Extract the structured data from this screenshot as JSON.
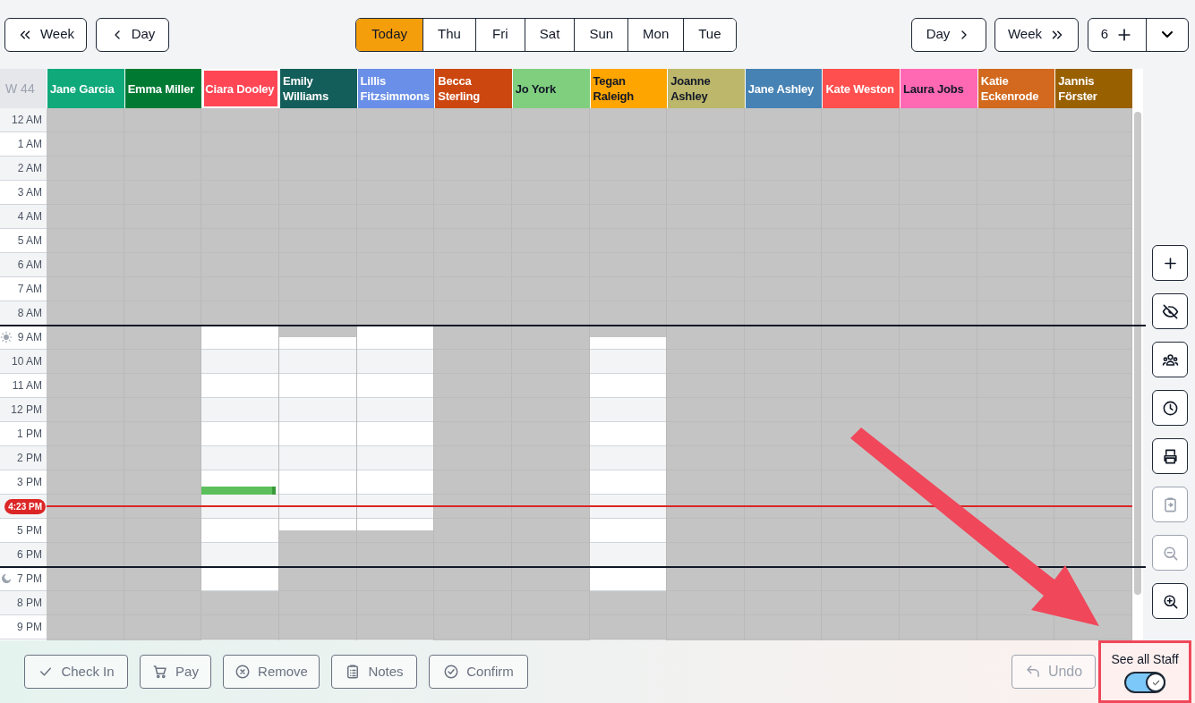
{
  "nav": {
    "prev_week": "Week",
    "prev_day": "Day",
    "next_day": "Day",
    "next_week": "Week"
  },
  "day_tabs": [
    {
      "label": "Today",
      "selected": true
    },
    {
      "label": "Thu",
      "selected": false
    },
    {
      "label": "Fri",
      "selected": false
    },
    {
      "label": "Sat",
      "selected": false
    },
    {
      "label": "Sun",
      "selected": false
    },
    {
      "label": "Mon",
      "selected": false
    },
    {
      "label": "Tue",
      "selected": false
    }
  ],
  "add_count": "6",
  "week_label": "W 44",
  "staff": [
    {
      "name": "Jane Garcia",
      "color": "#10a97a",
      "label_dark": false,
      "selected": false,
      "booking": false
    },
    {
      "name": "Emma Miller",
      "color": "#007a33",
      "label_dark": false,
      "selected": false,
      "booking": false
    },
    {
      "name": "Ciara Dooley",
      "color": "#ff4655",
      "label_dark": false,
      "selected": true,
      "booking": true,
      "open_slots": [
        false,
        false,
        false,
        false,
        false,
        false,
        false,
        false,
        false,
        false,
        false,
        false,
        false,
        false,
        false,
        false,
        false,
        false,
        true,
        true,
        true,
        true,
        true,
        true,
        true,
        true,
        true,
        true,
        true,
        true,
        true,
        true,
        true,
        true,
        true,
        true,
        true,
        true,
        true,
        true,
        false,
        false,
        false,
        false
      ]
    },
    {
      "name": "Emily Williams",
      "color": "#135e5a",
      "label_dark": false,
      "selected": false,
      "booking": false,
      "open_slots": [
        false,
        false,
        false,
        false,
        false,
        false,
        false,
        false,
        false,
        false,
        false,
        false,
        false,
        false,
        false,
        false,
        false,
        false,
        false,
        true,
        true,
        true,
        true,
        true,
        true,
        true,
        true,
        true,
        true,
        true,
        true,
        true,
        true,
        true,
        true,
        false,
        false,
        false,
        false,
        false,
        false,
        false,
        false,
        false
      ]
    },
    {
      "name": "Lillis Fitzsimmons",
      "color": "#6a8fe8",
      "label_dark": false,
      "selected": false,
      "booking": false,
      "open_slots": [
        false,
        false,
        false,
        false,
        false,
        false,
        false,
        false,
        false,
        false,
        false,
        false,
        false,
        false,
        false,
        false,
        false,
        false,
        true,
        true,
        true,
        true,
        true,
        true,
        true,
        true,
        true,
        true,
        true,
        true,
        true,
        true,
        true,
        true,
        true,
        false,
        false,
        false,
        false,
        false,
        false,
        false,
        false,
        false
      ]
    },
    {
      "name": "Becca Sterling",
      "color": "#cc470f",
      "label_dark": false,
      "selected": false,
      "booking": false
    },
    {
      "name": "Jo York",
      "color": "#80cf7e",
      "label_dark": true,
      "selected": false,
      "booking": false
    },
    {
      "name": "Tegan Raleigh",
      "color": "#ffa500",
      "label_dark": true,
      "selected": false,
      "booking": false,
      "open_slots": [
        false,
        false,
        false,
        false,
        false,
        false,
        false,
        false,
        false,
        false,
        false,
        false,
        false,
        false,
        false,
        false,
        false,
        false,
        false,
        true,
        true,
        true,
        true,
        true,
        true,
        true,
        true,
        true,
        true,
        true,
        true,
        true,
        true,
        true,
        true,
        true,
        true,
        true,
        true,
        true,
        false,
        false,
        false,
        false
      ]
    },
    {
      "name": "Joanne Ashley",
      "color": "#bdb76b",
      "label_dark": true,
      "selected": false,
      "booking": false
    },
    {
      "name": "Jane Ashley",
      "color": "#4682b4",
      "label_dark": false,
      "selected": false,
      "booking": false
    },
    {
      "name": "Kate Weston",
      "color": "#ff4f4f",
      "label_dark": false,
      "selected": false,
      "booking": false
    },
    {
      "name": "Laura Jobs",
      "color": "#ff69b4",
      "label_dark": true,
      "selected": false,
      "booking": false
    },
    {
      "name": "Katie Eckenrode",
      "color": "#d2691e",
      "label_dark": false,
      "selected": false,
      "booking": false
    },
    {
      "name": "Jannis Förster",
      "color": "#996000",
      "label_dark": false,
      "selected": false,
      "booking": false
    }
  ],
  "hours": [
    {
      "label": "12 AM",
      "kind": "hour"
    },
    {
      "label": "1 AM",
      "kind": "hour"
    },
    {
      "label": "2 AM",
      "kind": "hour"
    },
    {
      "label": "3 AM",
      "kind": "hour"
    },
    {
      "label": "4 AM",
      "kind": "hour"
    },
    {
      "label": "5 AM",
      "kind": "hour"
    },
    {
      "label": "6 AM",
      "kind": "hour"
    },
    {
      "label": "7 AM",
      "kind": "hour"
    },
    {
      "label": "8 AM",
      "kind": "hour"
    },
    {
      "label": "9 AM",
      "kind": "sunrise"
    },
    {
      "label": "10 AM",
      "kind": "hour"
    },
    {
      "label": "11 AM",
      "kind": "hour"
    },
    {
      "label": "12 PM",
      "kind": "hour"
    },
    {
      "label": "1 PM",
      "kind": "hour"
    },
    {
      "label": "2 PM",
      "kind": "hour"
    },
    {
      "label": "3 PM",
      "kind": "hour"
    },
    {
      "label": "4:23 PM",
      "kind": "now"
    },
    {
      "label": "5 PM",
      "kind": "hour"
    },
    {
      "label": "6 PM",
      "kind": "hour"
    },
    {
      "label": "7 PM",
      "kind": "sunset"
    },
    {
      "label": "8 PM",
      "kind": "hour"
    },
    {
      "label": "9 PM",
      "kind": "hour"
    }
  ],
  "tools": [
    {
      "kind": "add",
      "disabled": false
    },
    {
      "kind": "hide",
      "disabled": false
    },
    {
      "kind": "people",
      "disabled": false
    },
    {
      "kind": "clock",
      "disabled": false
    },
    {
      "kind": "print",
      "disabled": false
    },
    {
      "kind": "paste",
      "disabled": true
    },
    {
      "kind": "zoom_out",
      "disabled": true
    },
    {
      "kind": "zoom_in",
      "disabled": false
    }
  ],
  "actions": [
    {
      "label": "Check In",
      "kind": "check"
    },
    {
      "label": "Pay",
      "kind": "cart"
    },
    {
      "label": "Remove",
      "kind": "remove"
    },
    {
      "label": "Notes",
      "kind": "notes"
    },
    {
      "label": "Confirm",
      "kind": "confirm"
    }
  ],
  "undo": {
    "label": "Undo",
    "disabled": true
  },
  "see_all_staff": {
    "label": "See all Staff",
    "on": true
  }
}
